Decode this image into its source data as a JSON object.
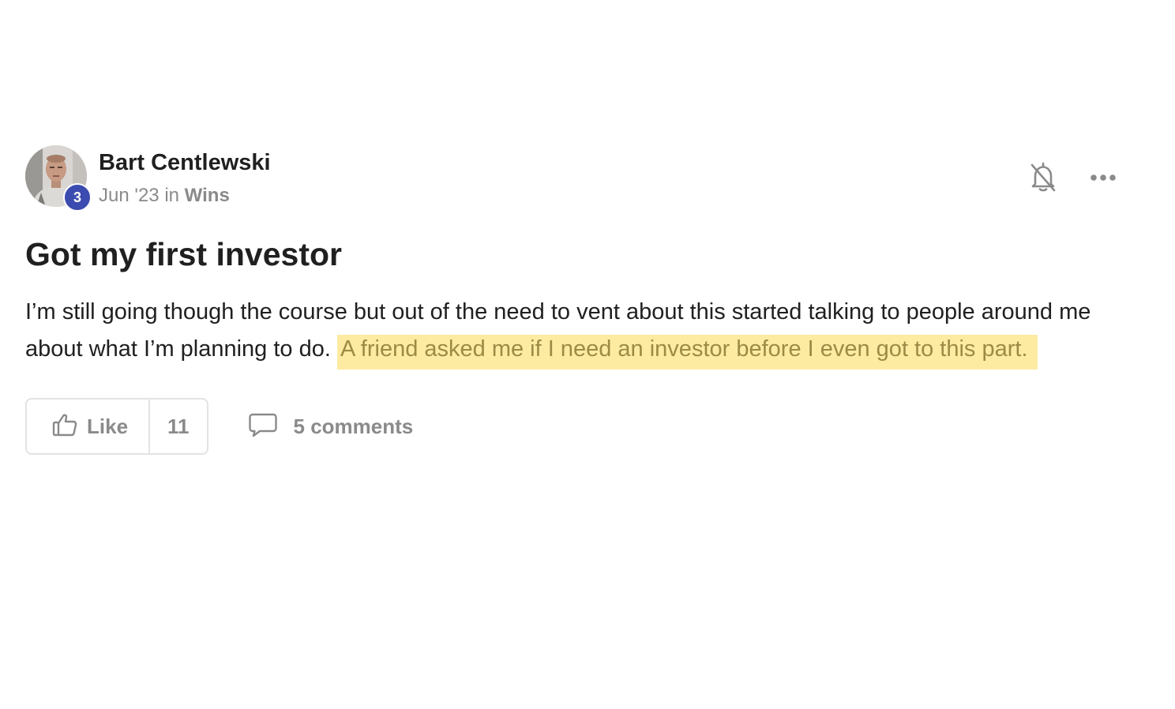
{
  "post": {
    "author": {
      "name": "Bart Centlewski",
      "level": "3",
      "avatar_icon": "user-photo"
    },
    "meta": {
      "date": "Jun '23",
      "in_word": "in",
      "category": "Wins"
    },
    "header_icons": {
      "bell": "bell-off-icon",
      "more": "more-horizontal-icon"
    },
    "title": "Got my first investor",
    "body": {
      "text": "I’m still going though the course but out of the need to vent about this started talking to people around me about what I’m planning to do.",
      "highlighted": "A friend asked me if I need an investor before I even got to this part."
    },
    "actions": {
      "like_label": "Like",
      "like_count": "11",
      "comments_label": "5 comments"
    },
    "colors": {
      "highlight_bg": "#fdeba2",
      "highlight_text": "#9c8b45",
      "badge": "#3c4bb0",
      "muted": "#8a8a8a"
    }
  }
}
